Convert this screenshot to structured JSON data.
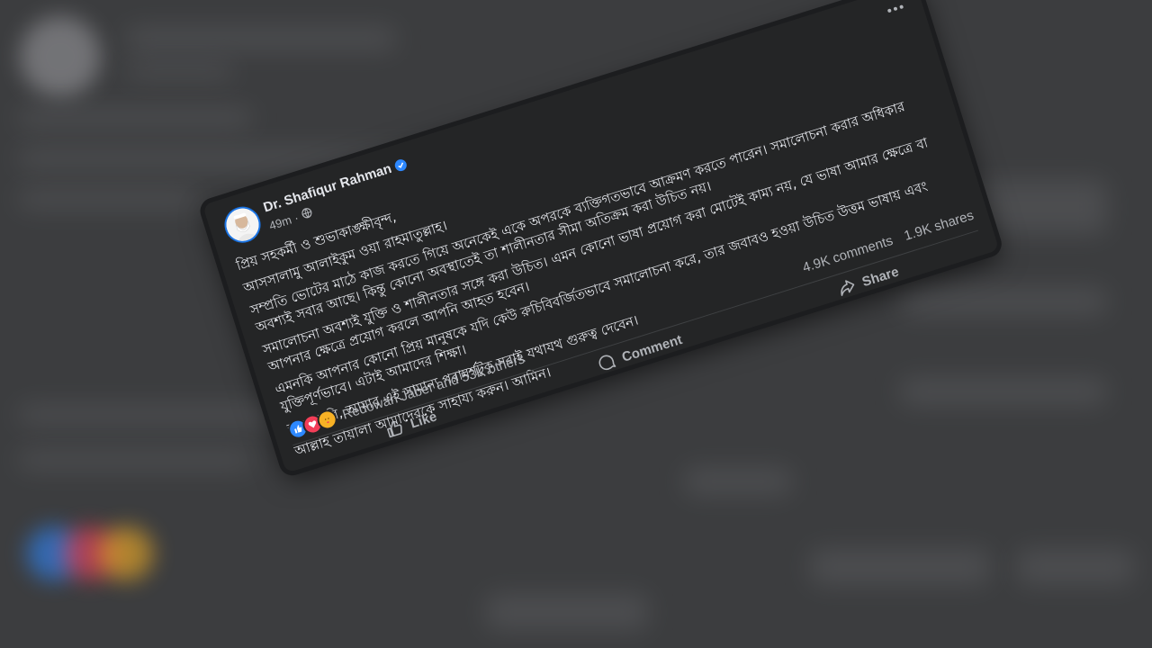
{
  "post": {
    "author": "Dr. Shafiqur Rahman",
    "time": "49m",
    "separator": "·",
    "paragraphs": [
      "প্রিয় সহকর্মী ও শুভাকাঙ্ক্ষীবৃন্দ,",
      "আসসালামু আলাইকুম ওয়া রাহমাতুল্লাহ।",
      "সম্প্রতি ভোটের মাঠে কাজ করতে গিয়ে অনেকেই একে অপরকে ব্যক্তিগতভাবে আক্রমণ করতে পারেন। সমালোচনা করার অধিকার অবশ্যই সবার আছে। কিন্তু কোনো অবস্থাতেই তা শালীনতার সীমা অতিক্রম করা উচিত নয়।",
      "সমালোচনা অবশ্যই যুক্তি ও শালীনতার সঙ্গে করা উচিত। এমন কোনো ভাষা প্রয়োগ করা মোটেই কাম্য নয়, যে ভাষা আমার ক্ষেত্রে বা আপনার ক্ষেত্রে প্রয়োগ করলে আপনি আহত হবেন।",
      "এমনকি আপনার কোনো প্রিয় মানুষকে যদি কেউ রুচিবিবর্জিতভাবে সমালোচনা করে, তার জবাবও হওয়া উচিত উত্তম ভাষায় এবং যুক্তিপূর্ণভাবে। এটাই আমাদের শিক্ষা।",
      "আশা করি, আমার এই সামান্য পরামর্শটুকু সবাই যথাযথ গুরুত্ব দেবেন।",
      "আল্লাহ তায়ালা আমাদেরকে সাহায্য করুন। আমিন।"
    ]
  },
  "reactions": {
    "summary": "Redowan Jaber and 53K others",
    "types": [
      "like-icon",
      "love-icon",
      "care-icon"
    ]
  },
  "stats": {
    "comments": "4.9K comments",
    "shares": "1.9K shares"
  },
  "actions": {
    "like": "Like",
    "comment": "Comment",
    "share": "Share"
  },
  "colors": {
    "card_bg": "#242526",
    "text": "#e4e6eb",
    "secondary_text": "#b0b3b8",
    "accent": "#2d88ff"
  }
}
